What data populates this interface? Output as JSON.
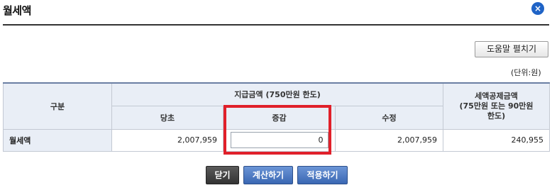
{
  "dialog": {
    "title": "월세액",
    "close_icon_glyph": "×"
  },
  "help_button_label": "도움말 펼치기",
  "unit_note": "(단위:원)",
  "table": {
    "col_category": "구분",
    "group_payment": "지급금액 (750만원 한도)",
    "col_original": "당초",
    "col_change": "증감",
    "col_corrected": "수정",
    "col_deduction": "세액공제금액\n(75만원 또는 90만원\n한도)",
    "row": {
      "label": "월세액",
      "original": "2,007,959",
      "change_value": "0",
      "corrected": "2,007,959",
      "deduction": "240,955"
    }
  },
  "buttons": {
    "close": "닫기",
    "calculate": "계산하기",
    "apply": "적용하기"
  },
  "colors": {
    "highlight": "#e0202a",
    "accent_blue": "#3a67b3",
    "close_icon_bg": "#1f63c6"
  }
}
